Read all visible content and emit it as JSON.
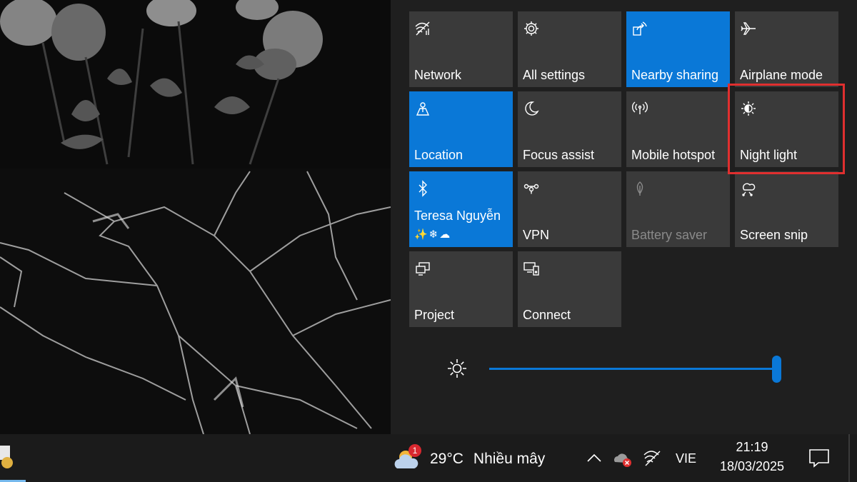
{
  "tiles": [
    {
      "label": "Network",
      "icon": "network-icon",
      "state": "off"
    },
    {
      "label": "All settings",
      "icon": "gear-icon",
      "state": "off"
    },
    {
      "label": "Nearby sharing",
      "icon": "nearby-sharing-icon",
      "state": "on"
    },
    {
      "label": "Airplane mode",
      "icon": "airplane-icon",
      "state": "off"
    },
    {
      "label": "Location",
      "icon": "location-icon",
      "state": "on"
    },
    {
      "label": "Focus assist",
      "icon": "moon-icon",
      "state": "off"
    },
    {
      "label": "Mobile hotspot",
      "icon": "hotspot-icon",
      "state": "off"
    },
    {
      "label": "Night light",
      "icon": "night-light-icon",
      "state": "off"
    },
    {
      "label": "Teresa Nguyễn",
      "icon": "bluetooth-icon",
      "state": "on",
      "extra": "✨❄☁"
    },
    {
      "label": "VPN",
      "icon": "vpn-icon",
      "state": "off"
    },
    {
      "label": "Battery saver",
      "icon": "battery-saver-icon",
      "state": "disabled"
    },
    {
      "label": "Screen snip",
      "icon": "screen-snip-icon",
      "state": "off"
    },
    {
      "label": "Project",
      "icon": "project-icon",
      "state": "off"
    },
    {
      "label": "Connect",
      "icon": "connect-icon",
      "state": "off"
    }
  ],
  "brightness": {
    "icon": "brightness-icon",
    "level": 1.0
  },
  "taskbar": {
    "weather": {
      "badge": "1",
      "temperature": "29°C",
      "description": "Nhiều mây"
    },
    "language": "VIE",
    "clock": {
      "time": "21:19",
      "date": "18/03/2025"
    }
  },
  "colors": {
    "accent": "#0a78d7",
    "tile_off": "#3a3a3a",
    "highlight": "#e02f2f",
    "panel": "#1f1f1f"
  }
}
